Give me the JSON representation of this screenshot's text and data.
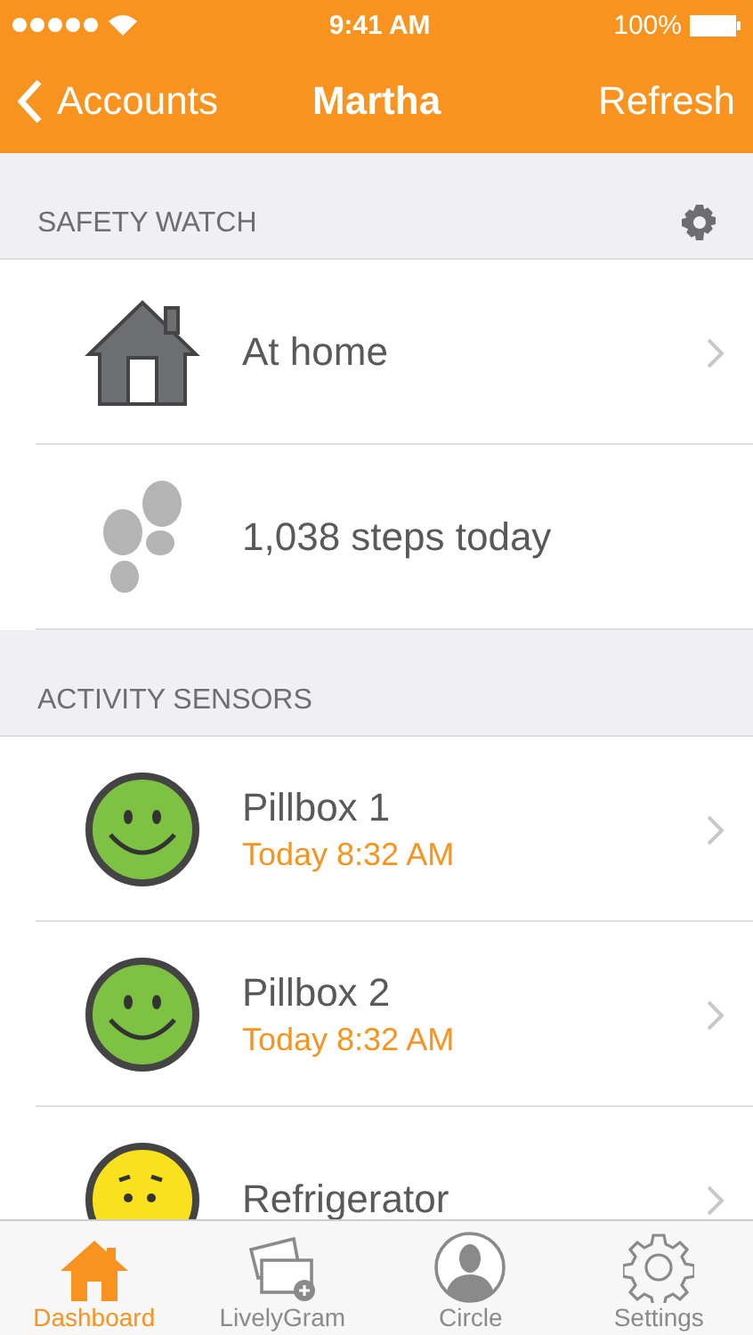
{
  "status_bar": {
    "time": "9:41 AM",
    "battery": "100%"
  },
  "nav": {
    "back": "Accounts",
    "title": "Martha",
    "action": "Refresh"
  },
  "sections": [
    {
      "header": "SAFETY WATCH",
      "settings": true,
      "rows": [
        {
          "kind": "home",
          "title": "At home",
          "disclosure": true
        },
        {
          "kind": "steps",
          "title": "1,038 steps today",
          "disclosure": false
        }
      ]
    },
    {
      "header": "ACTIVITY SENSORS",
      "settings": false,
      "rows": [
        {
          "kind": "happy",
          "title": "Pillbox 1",
          "time": "Today 8:32 AM",
          "disclosure": true
        },
        {
          "kind": "happy",
          "title": "Pillbox 2",
          "time": "Today 8:32 AM",
          "disclosure": true
        },
        {
          "kind": "neutral",
          "title": "Refrigerator",
          "disclosure": true
        }
      ]
    }
  ],
  "tabs": [
    {
      "label": "Dashboard",
      "selected": true
    },
    {
      "label": "LivelyGram",
      "selected": false
    },
    {
      "label": "Circle",
      "selected": false
    },
    {
      "label": "Settings",
      "selected": false
    }
  ]
}
